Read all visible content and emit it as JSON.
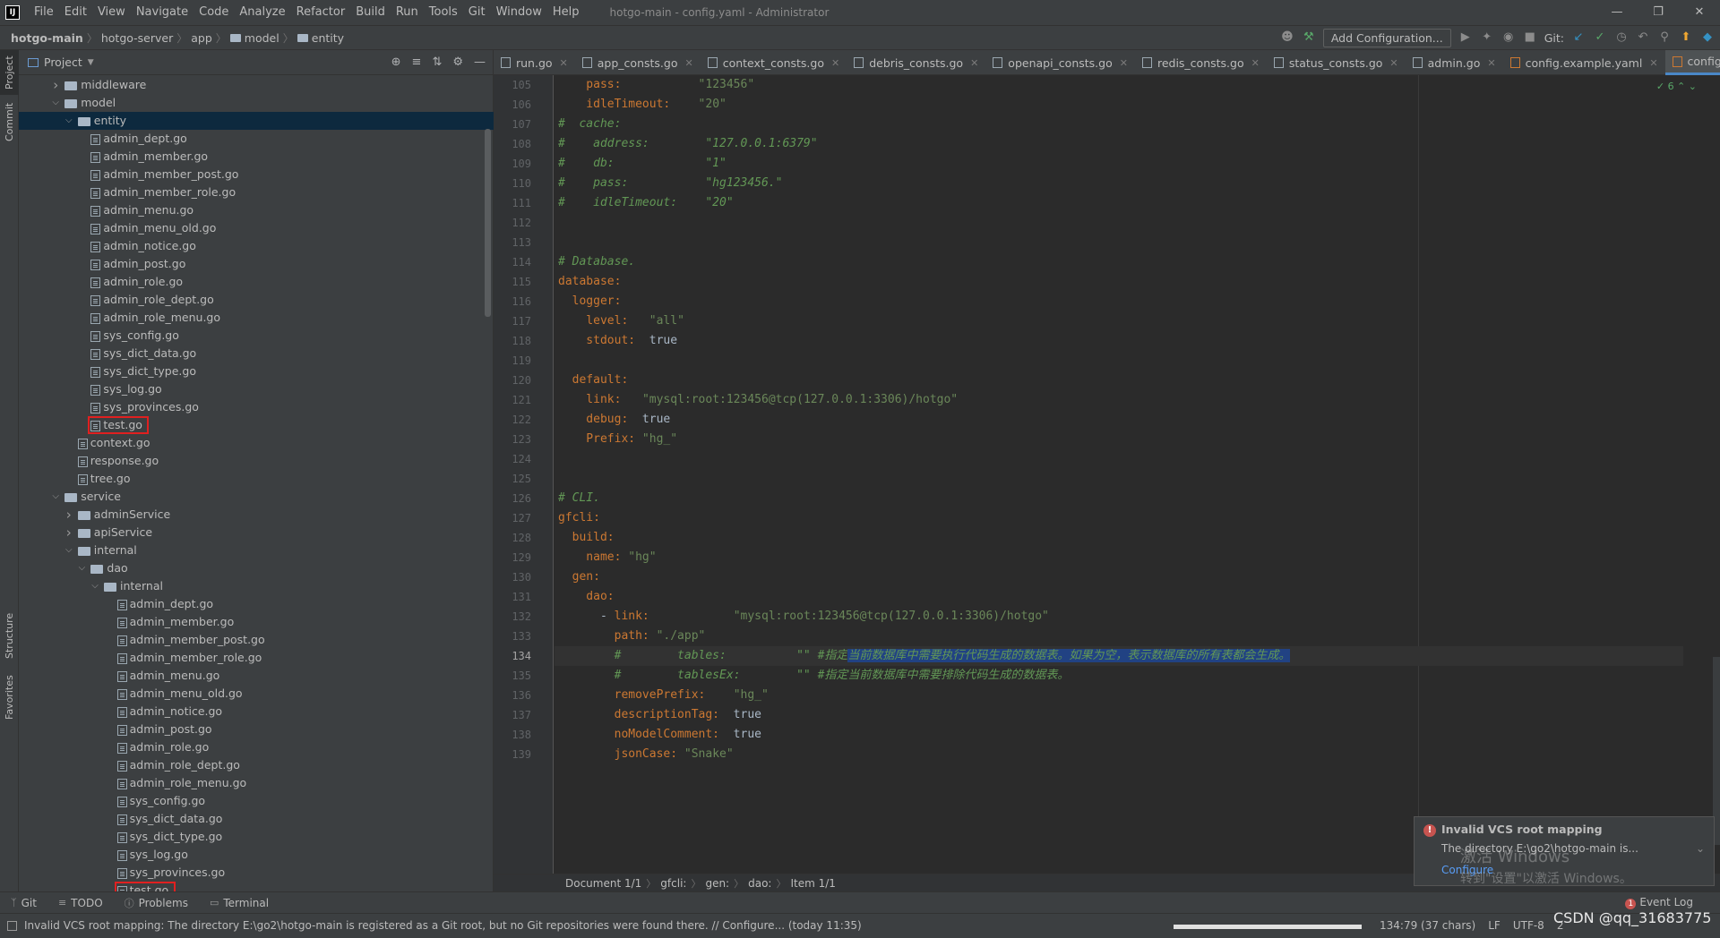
{
  "menubar": {
    "items": [
      "File",
      "Edit",
      "View",
      "Navigate",
      "Code",
      "Analyze",
      "Refactor",
      "Build",
      "Run",
      "Tools",
      "Git",
      "Window",
      "Help"
    ],
    "title": "hotgo-main - config.yaml - Administrator"
  },
  "navbar": {
    "crumbs": [
      "hotgo-main",
      "hotgo-server",
      "app",
      "model",
      "entity"
    ],
    "add_config": "Add Configuration...",
    "git_label": "Git:"
  },
  "left_strip": {
    "project": "Project",
    "commit": "Commit",
    "structure": "Structure",
    "favorites": "Favorites"
  },
  "project_panel": {
    "title": "Project",
    "tree": [
      {
        "label": "middleware",
        "type": "folder",
        "depth": 3,
        "open": false
      },
      {
        "label": "model",
        "type": "folder",
        "depth": 3,
        "open": true
      },
      {
        "label": "entity",
        "type": "folder",
        "depth": 4,
        "open": true,
        "selected": true
      },
      {
        "label": "admin_dept.go",
        "type": "file",
        "depth": 5
      },
      {
        "label": "admin_member.go",
        "type": "file",
        "depth": 5
      },
      {
        "label": "admin_member_post.go",
        "type": "file",
        "depth": 5
      },
      {
        "label": "admin_member_role.go",
        "type": "file",
        "depth": 5
      },
      {
        "label": "admin_menu.go",
        "type": "file",
        "depth": 5
      },
      {
        "label": "admin_menu_old.go",
        "type": "file",
        "depth": 5
      },
      {
        "label": "admin_notice.go",
        "type": "file",
        "depth": 5
      },
      {
        "label": "admin_post.go",
        "type": "file",
        "depth": 5
      },
      {
        "label": "admin_role.go",
        "type": "file",
        "depth": 5
      },
      {
        "label": "admin_role_dept.go",
        "type": "file",
        "depth": 5
      },
      {
        "label": "admin_role_menu.go",
        "type": "file",
        "depth": 5
      },
      {
        "label": "sys_config.go",
        "type": "file",
        "depth": 5
      },
      {
        "label": "sys_dict_data.go",
        "type": "file",
        "depth": 5
      },
      {
        "label": "sys_dict_type.go",
        "type": "file",
        "depth": 5
      },
      {
        "label": "sys_log.go",
        "type": "file",
        "depth": 5
      },
      {
        "label": "sys_provinces.go",
        "type": "file",
        "depth": 5
      },
      {
        "label": "test.go",
        "type": "file",
        "depth": 5,
        "highlight": true
      },
      {
        "label": "context.go",
        "type": "file",
        "depth": 4
      },
      {
        "label": "response.go",
        "type": "file",
        "depth": 4
      },
      {
        "label": "tree.go",
        "type": "file",
        "depth": 4
      },
      {
        "label": "service",
        "type": "folder",
        "depth": 3,
        "open": true
      },
      {
        "label": "adminService",
        "type": "folder",
        "depth": 4,
        "open": false
      },
      {
        "label": "apiService",
        "type": "folder",
        "depth": 4,
        "open": false
      },
      {
        "label": "internal",
        "type": "folder",
        "depth": 4,
        "open": true
      },
      {
        "label": "dao",
        "type": "folder",
        "depth": 5,
        "open": true
      },
      {
        "label": "internal",
        "type": "folder",
        "depth": 6,
        "open": true
      },
      {
        "label": "admin_dept.go",
        "type": "file",
        "depth": 7
      },
      {
        "label": "admin_member.go",
        "type": "file",
        "depth": 7
      },
      {
        "label": "admin_member_post.go",
        "type": "file",
        "depth": 7
      },
      {
        "label": "admin_member_role.go",
        "type": "file",
        "depth": 7
      },
      {
        "label": "admin_menu.go",
        "type": "file",
        "depth": 7
      },
      {
        "label": "admin_menu_old.go",
        "type": "file",
        "depth": 7
      },
      {
        "label": "admin_notice.go",
        "type": "file",
        "depth": 7
      },
      {
        "label": "admin_post.go",
        "type": "file",
        "depth": 7
      },
      {
        "label": "admin_role.go",
        "type": "file",
        "depth": 7
      },
      {
        "label": "admin_role_dept.go",
        "type": "file",
        "depth": 7
      },
      {
        "label": "admin_role_menu.go",
        "type": "file",
        "depth": 7
      },
      {
        "label": "sys_config.go",
        "type": "file",
        "depth": 7
      },
      {
        "label": "sys_dict_data.go",
        "type": "file",
        "depth": 7
      },
      {
        "label": "sys_dict_type.go",
        "type": "file",
        "depth": 7
      },
      {
        "label": "sys_log.go",
        "type": "file",
        "depth": 7
      },
      {
        "label": "sys_provinces.go",
        "type": "file",
        "depth": 7
      },
      {
        "label": "test.go",
        "type": "file",
        "depth": 7,
        "highlight": true
      }
    ]
  },
  "tabs": [
    {
      "label": "run.go",
      "kind": "go"
    },
    {
      "label": "app_consts.go",
      "kind": "go"
    },
    {
      "label": "context_consts.go",
      "kind": "go"
    },
    {
      "label": "debris_consts.go",
      "kind": "go"
    },
    {
      "label": "openapi_consts.go",
      "kind": "go"
    },
    {
      "label": "redis_consts.go",
      "kind": "go"
    },
    {
      "label": "status_consts.go",
      "kind": "go"
    },
    {
      "label": "admin.go",
      "kind": "go"
    },
    {
      "label": "config.example.yaml",
      "kind": "yaml"
    },
    {
      "label": "config.yaml",
      "kind": "yaml",
      "active": true
    }
  ],
  "inspection_count": "6",
  "editor": {
    "current_line": 134,
    "lines": [
      {
        "n": 105,
        "parts": [
          [
            "k",
            "    pass:"
          ],
          [
            "",
            "           "
          ],
          [
            "s",
            "\"123456\""
          ]
        ]
      },
      {
        "n": 106,
        "parts": [
          [
            "k",
            "    idleTimeout:"
          ],
          [
            "",
            "    "
          ],
          [
            "s",
            "\"20\""
          ]
        ]
      },
      {
        "n": 107,
        "parts": [
          [
            "c",
            "#  cache:"
          ]
        ]
      },
      {
        "n": 108,
        "parts": [
          [
            "c",
            "#    address:        \"127.0.0.1:6379\""
          ]
        ]
      },
      {
        "n": 109,
        "parts": [
          [
            "c",
            "#    db:             \"1\""
          ]
        ]
      },
      {
        "n": 110,
        "parts": [
          [
            "c",
            "#    pass:           \"hg123456.\""
          ]
        ]
      },
      {
        "n": 111,
        "parts": [
          [
            "c",
            "#    idleTimeout:    \"20\""
          ]
        ]
      },
      {
        "n": 112,
        "parts": []
      },
      {
        "n": 113,
        "parts": []
      },
      {
        "n": 114,
        "parts": [
          [
            "c",
            "# Database."
          ]
        ]
      },
      {
        "n": 115,
        "parts": [
          [
            "k",
            "database:"
          ]
        ]
      },
      {
        "n": 116,
        "parts": [
          [
            "k",
            "  logger:"
          ]
        ]
      },
      {
        "n": 117,
        "parts": [
          [
            "k",
            "    level:"
          ],
          [
            "",
            "   "
          ],
          [
            "s",
            "\"all\""
          ]
        ]
      },
      {
        "n": 118,
        "parts": [
          [
            "k",
            "    stdout:"
          ],
          [
            "",
            "  true"
          ]
        ]
      },
      {
        "n": 119,
        "parts": []
      },
      {
        "n": 120,
        "parts": [
          [
            "k",
            "  default:"
          ]
        ]
      },
      {
        "n": 121,
        "parts": [
          [
            "k",
            "    link:"
          ],
          [
            "",
            "   "
          ],
          [
            "s",
            "\"mysql:root:123456@tcp(127.0.0.1:3306)/hotgo\""
          ]
        ]
      },
      {
        "n": 122,
        "parts": [
          [
            "k",
            "    debug:"
          ],
          [
            "",
            "  true"
          ]
        ]
      },
      {
        "n": 123,
        "parts": [
          [
            "k",
            "    Prefix:"
          ],
          [
            "",
            " "
          ],
          [
            "s",
            "\"hg_\""
          ]
        ]
      },
      {
        "n": 124,
        "parts": []
      },
      {
        "n": 125,
        "parts": []
      },
      {
        "n": 126,
        "parts": [
          [
            "c",
            "# CLI."
          ]
        ]
      },
      {
        "n": 127,
        "parts": [
          [
            "k",
            "gfcli:"
          ]
        ]
      },
      {
        "n": 128,
        "parts": [
          [
            "k",
            "  build:"
          ]
        ]
      },
      {
        "n": 129,
        "parts": [
          [
            "k",
            "    name:"
          ],
          [
            "",
            " "
          ],
          [
            "s",
            "\"hg\""
          ]
        ]
      },
      {
        "n": 130,
        "parts": [
          [
            "k",
            "  gen:"
          ]
        ]
      },
      {
        "n": 131,
        "parts": [
          [
            "k",
            "    dao:"
          ]
        ]
      },
      {
        "n": 132,
        "parts": [
          [
            "",
            "      - "
          ],
          [
            "k",
            "link:"
          ],
          [
            "",
            "            "
          ],
          [
            "s",
            "\"mysql:root:123456@tcp(127.0.0.1:3306)/hotgo\""
          ]
        ]
      },
      {
        "n": 133,
        "parts": [
          [
            "k",
            "        path:"
          ],
          [
            "",
            " "
          ],
          [
            "s",
            "\"./app\""
          ]
        ]
      },
      {
        "n": 134,
        "parts": [
          [
            "c",
            "        #        tables:          \"\" #指定"
          ],
          [
            "csel",
            "当前数据库中需要执行代码生成的数据表。如果为空，表示数据库的所有表都会生成。"
          ]
        ]
      },
      {
        "n": 135,
        "parts": [
          [
            "c",
            "        #        tablesEx:        \"\" #指定当前数据库中需要排除代码生成的数据表。"
          ]
        ]
      },
      {
        "n": 136,
        "parts": [
          [
            "k",
            "        removePrefix:"
          ],
          [
            "",
            "    "
          ],
          [
            "s",
            "\"hg_\""
          ]
        ]
      },
      {
        "n": 137,
        "parts": [
          [
            "k",
            "        descriptionTag:"
          ],
          [
            "",
            "  true"
          ]
        ]
      },
      {
        "n": 138,
        "parts": [
          [
            "k",
            "        noModelComment:"
          ],
          [
            "",
            "  true"
          ]
        ]
      },
      {
        "n": 139,
        "parts": [
          [
            "k",
            "        jsonCase:"
          ],
          [
            "",
            " "
          ],
          [
            "s",
            "\"Snake\""
          ]
        ]
      }
    ]
  },
  "editor_breadcrumbs": [
    "Document 1/1",
    "gfcli:",
    "gen:",
    "dao:",
    "Item 1/1"
  ],
  "notification": {
    "title": "Invalid VCS root mapping",
    "body": "The directory E:\\go2\\hotgo-main is...",
    "link": "Configure"
  },
  "watermark": {
    "line1": "激活 Windows",
    "line2": "转到\"设置\"以激活 Windows。"
  },
  "bottom_tools": [
    "Git",
    "TODO",
    "Problems",
    "Terminal"
  ],
  "event_log": "Event Log",
  "statusbar": {
    "message": "Invalid VCS root mapping: The directory E:\\go2\\hotgo-main is registered as a Git root, but no Git repositories were found there. // Configure... (today 11:35)",
    "position": "134:79 (37 chars)",
    "line_sep": "LF",
    "encoding": "UTF-8",
    "indent": "2"
  },
  "csdn_mark": "CSDN @qq_31683775"
}
